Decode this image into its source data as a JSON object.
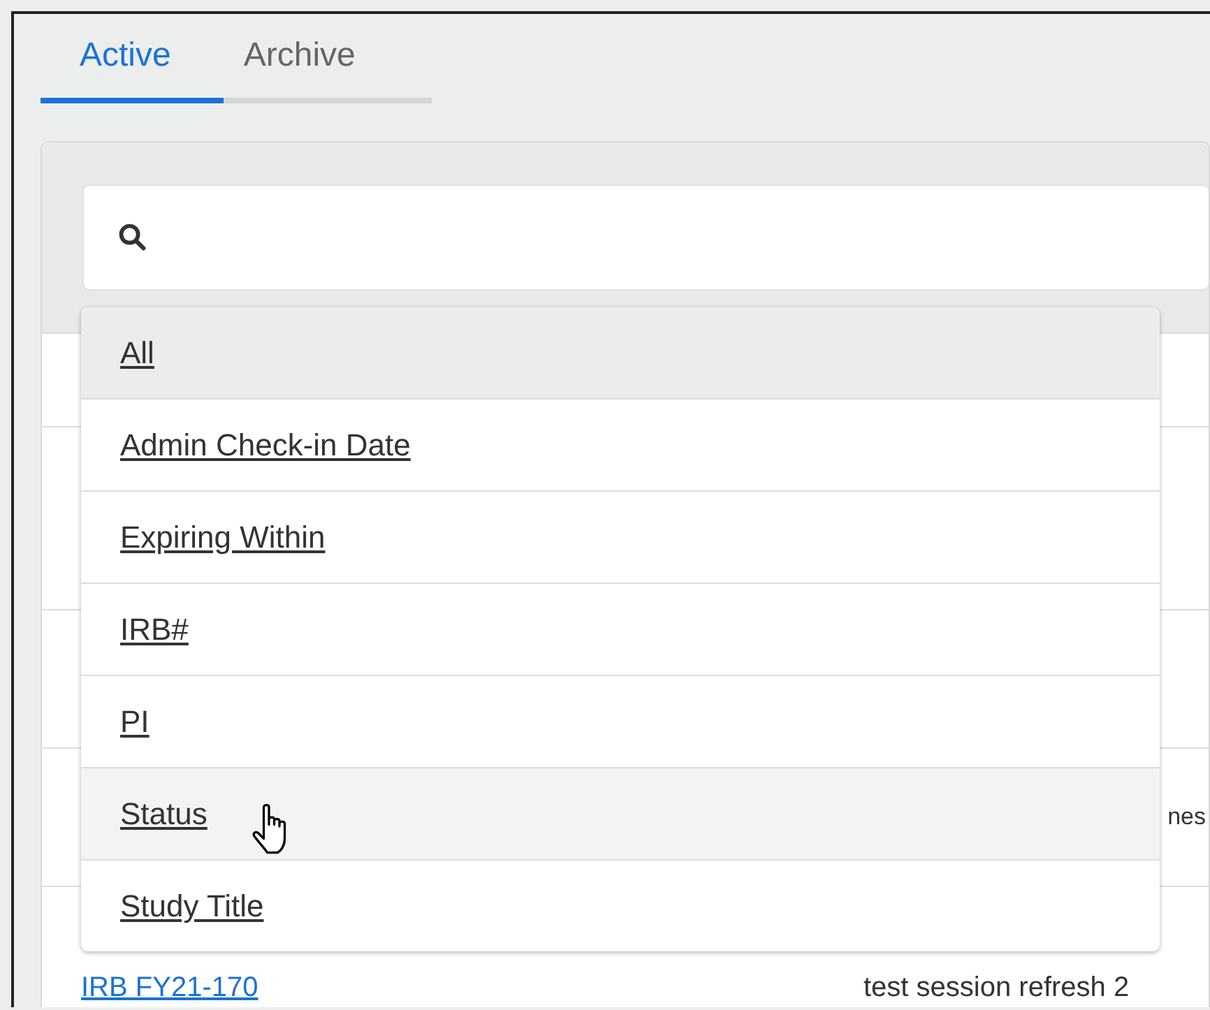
{
  "tabs": [
    {
      "label": "Active",
      "selected": true
    },
    {
      "label": "Archive",
      "selected": false
    }
  ],
  "filter_menu": [
    {
      "label": "All",
      "selected": true,
      "hovered": false
    },
    {
      "label": "Admin Check-in Date",
      "selected": false,
      "hovered": false
    },
    {
      "label": "Expiring Within",
      "selected": false,
      "hovered": false
    },
    {
      "label": "IRB#",
      "selected": false,
      "hovered": false
    },
    {
      "label": "PI",
      "selected": false,
      "hovered": false
    },
    {
      "label": "Status",
      "selected": false,
      "hovered": true
    },
    {
      "label": "Study Title",
      "selected": false,
      "hovered": false
    }
  ],
  "table": {
    "rows": [
      {},
      {},
      {},
      {
        "column_2": "nes"
      },
      {
        "column_1": "IRB FY21-170",
        "column_2": "test session refresh 2"
      }
    ]
  }
}
